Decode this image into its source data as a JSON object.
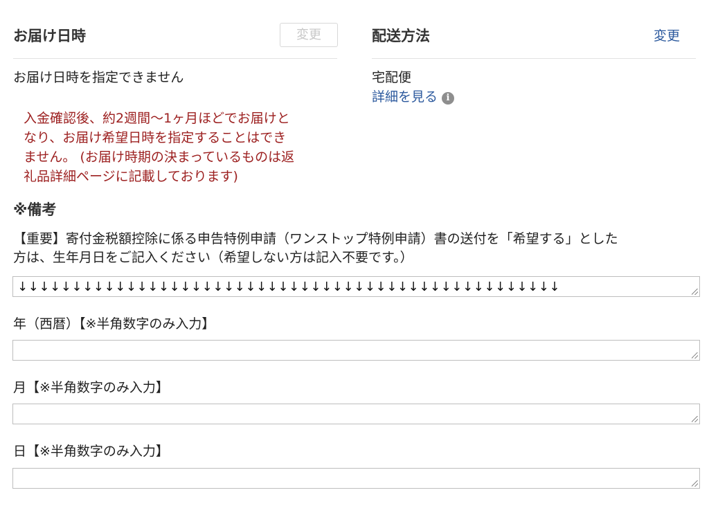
{
  "delivery_datetime": {
    "title": "お届け日時",
    "change_label": "変更",
    "note": "お届け日時を指定できません",
    "warning_lines": [
      "入金確認後、約2週間〜1ヶ月ほどでお届けと",
      "なり、お届け希望日時を指定することはでき",
      "ません。 (お届け時期の決まっているものは返",
      "礼品詳細ページに記載しております)"
    ]
  },
  "shipping_method": {
    "title": "配送方法",
    "change_label": "変更",
    "method": "宅配便",
    "details_link": "詳細を見る",
    "info_icon": "i"
  },
  "remarks": {
    "title": "※備考",
    "description_lines": [
      "【重要】寄付金税額控除に係る申告特例申請（ワンストップ特例申請）書の送付を「希望する」とした",
      "方は、生年月日をご記入ください（希望しない方は記入不要です。）"
    ],
    "arrows_value": "↓↓↓↓↓↓↓↓↓↓↓↓↓↓↓↓↓↓↓↓↓↓↓↓↓↓↓↓↓↓↓↓↓↓↓↓↓↓↓↓↓↓↓↓↓↓↓↓↓↓",
    "year_label": "年（西暦）【※半角数字のみ入力】",
    "month_label": "月【※半角数字のみ入力】",
    "day_label": "日【※半角数字のみ入力】",
    "year_value": "",
    "month_value": "",
    "day_value": ""
  }
}
